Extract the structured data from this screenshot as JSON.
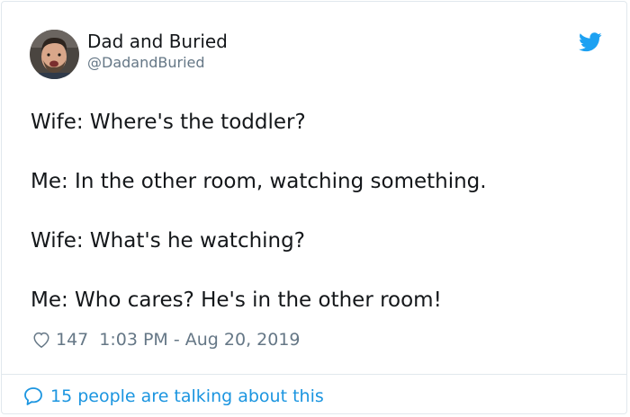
{
  "user": {
    "display_name": "Dad and Buried",
    "handle": "@DadandBuried"
  },
  "tweet": {
    "lines": [
      "Wife: Where's the toddler?",
      "Me: In the other room, watching something.",
      "Wife: What's he watching?",
      "Me: Who cares? He's in the other room!"
    ]
  },
  "meta": {
    "likes": "147",
    "timestamp": "1:03 PM - Aug 20, 2019"
  },
  "footer": {
    "conversation_label": "15 people are talking about this"
  },
  "colors": {
    "twitter_blue": "#1da1f2",
    "link_blue": "#1b95e0",
    "secondary_text": "#657786",
    "border": "#e1e8ed"
  },
  "icons": {
    "brand": "twitter-bird-icon",
    "like": "heart-icon",
    "reply": "speech-bubble-icon"
  }
}
